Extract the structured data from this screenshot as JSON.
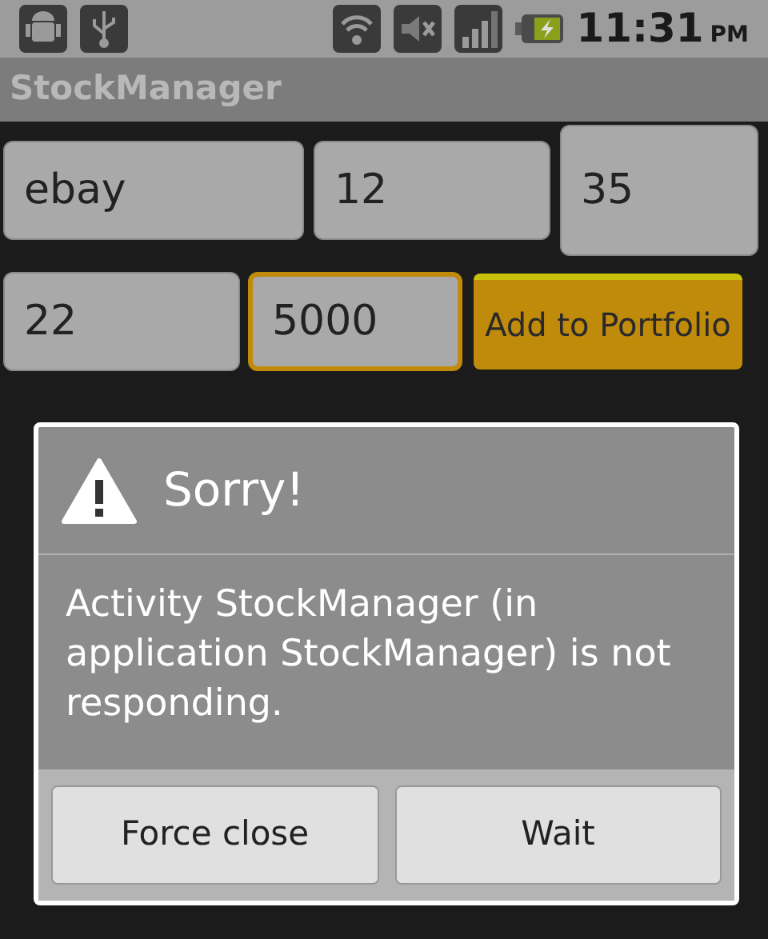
{
  "status_bar": {
    "time": "11:31",
    "period": "PM"
  },
  "app_title": "StockManager",
  "fields": [
    {
      "value": "ebay",
      "focused": false
    },
    {
      "value": "12",
      "focused": false
    },
    {
      "value": "35",
      "focused": false
    },
    {
      "value": "22",
      "focused": false
    },
    {
      "value": "5000",
      "focused": true
    }
  ],
  "add_button": "Add to Portfolio",
  "dialog": {
    "title": "Sorry!",
    "message": "Activity StockManager (in application StockManager) is not responding.",
    "buttons": [
      "Force close",
      "Wait"
    ]
  }
}
